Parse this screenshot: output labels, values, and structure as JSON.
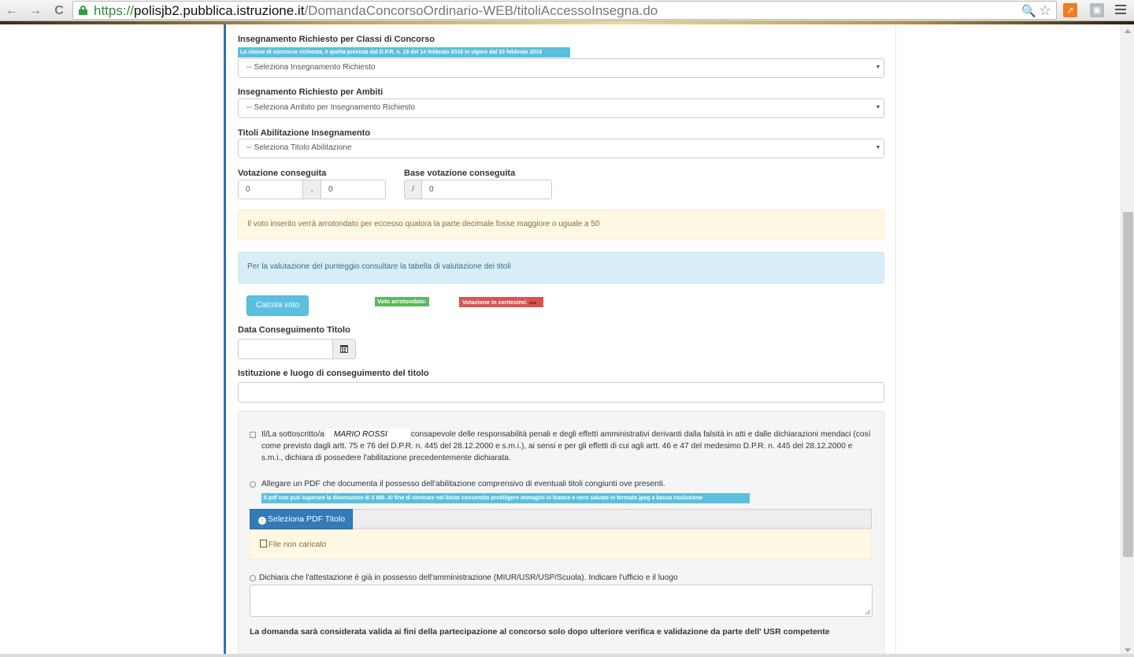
{
  "browser": {
    "url_scheme": "https://",
    "url_host": "polisjb2.pubblica.istruzione.it",
    "url_path": "/DomandaConcorsoOrdinario-WEB/titoliAccessoInsegna.do",
    "back_glyph": "←",
    "forward_glyph": "→",
    "reload_glyph": "C",
    "zoom_glyph": "🔍",
    "star_glyph": "☆"
  },
  "form": {
    "classi": {
      "label": "Insegnamento Richiesto per Classi di Concorso",
      "hint": "La classe di concorso richiesta, è quella prevista dal D.P.R. n. 19 del 14 febbraio 2016 in vigore dal 23 febbraio 2016",
      "selected": "-- Seleziona Insegnamento Richiesto"
    },
    "ambiti": {
      "label": "Insegnamento Richiesto per Ambiti",
      "selected": "-- Seleziona Ambito per Insegnamento Richiesto"
    },
    "titoli": {
      "label": "Titoli Abilitazione Insegnamento",
      "selected": "-- Seleziona Titolo Abilitazione"
    },
    "votazione": {
      "label": "Votazione conseguita",
      "integer_value": "0",
      "separator": ",",
      "decimal_value": "0"
    },
    "base": {
      "label": "Base votazione conseguita",
      "separator": "/",
      "value": "0"
    },
    "warning_arrotondamento": "Il voto inserito verrà arrotondato per eccesso qualora la parte decimale fosse maggiore o uguale a 50",
    "info_valutazione": "Per la valutazione del punteggio consultare la tabella di valutazione dei titoli",
    "calcola_button": "Calcola voto",
    "voto_arrotondato_badge": "Voto arrotondato:",
    "votazione_centesimi_badge": "Votazione in centesimi:",
    "data": {
      "label": "Data Conseguimento Titolo",
      "value": ""
    },
    "istituzione": {
      "label": "Istituzione e luogo di conseguimento del titolo",
      "value": ""
    }
  },
  "declaration": {
    "prefix": "Il/La sottoscritto/a",
    "name": "MARIO ROSSI",
    "text": "consapevole delle responsabilità penali e degli effetti amministrativi derivanti dalla falsità in atti e dalle dichiarazioni mendaci (così come previsto dagli artt. 75 e 76 del D.P.R. n. 445 del 28.12.2000 e s.m.i.), ai sensi e per gli effetti di cui agli artt. 46 e 47 del medesimo D.P.R. n. 445 del 28.12.2000 e s.m.i., dichiara di possedere l'abilitazione precedentemente dichiarata.",
    "pdf_option": "Allegare un PDF che documenta il possesso dell'abilitazione comprensivo di eventuali titoli congiunti ove presenti.",
    "pdf_hint": "Il pdf non può superare la dimensione di 2 MB. Al fine di rientrare nel limite consentito prediligere immagini in bianco e nero salvate in formato jpeg a bassa risoluzione",
    "select_pdf_button": "Seleziona PDF Titolo",
    "file_status": "File non caricato",
    "dichiara_option": "Dichiara che l'attestazione è già in possesso dell'amministrazione (MIUR/USR/USP/Scuola). Indicare l'ufficio e il luogo",
    "dichiara_value": "",
    "final_note": "La domanda sarà considerata valida ai fini della partecipazione al concorso solo dopo ulteriore verifica e validazione da parte dell' USR competente"
  }
}
